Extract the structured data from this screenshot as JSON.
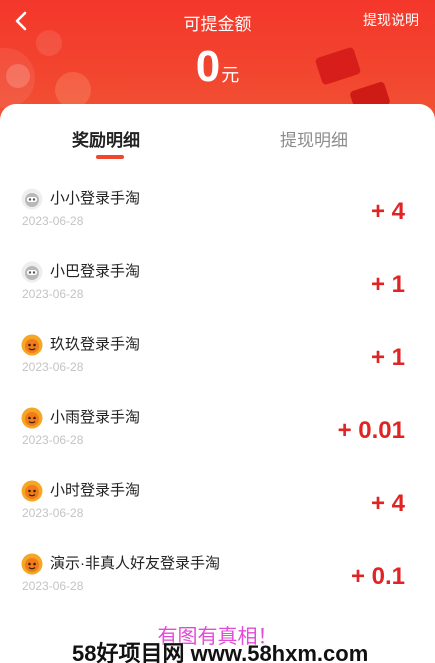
{
  "header": {
    "title": "可提金额",
    "rules_link": "提现说明",
    "amount": "0",
    "unit": "元",
    "bg_color": "#f4372b"
  },
  "tabs": [
    {
      "label": "奖励明细",
      "active": true
    },
    {
      "label": "提现明细",
      "active": false
    }
  ],
  "records": [
    {
      "name": "小小登录手淘",
      "date": "2023-06-28",
      "amount": "+ 4",
      "avatar": "gray-robot-icon"
    },
    {
      "name": "小巴登录手淘",
      "date": "2023-06-28",
      "amount": "+ 1",
      "avatar": "gray-robot-icon"
    },
    {
      "name": "玖玖登录手淘",
      "date": "2023-06-28",
      "amount": "+ 1",
      "avatar": "orange-smiley-icon"
    },
    {
      "name": "小雨登录手淘",
      "date": "2023-06-28",
      "amount": "+ 0.01",
      "avatar": "orange-smiley-icon"
    },
    {
      "name": "小时登录手淘",
      "date": "2023-06-28",
      "amount": "+ 4",
      "avatar": "orange-smiley-icon"
    },
    {
      "name": "演示·非真人好友登录手淘",
      "date": "2023-06-28",
      "amount": "+ 0.1",
      "avatar": "orange-smiley-icon"
    }
  ],
  "watermark": {
    "caption": "有图有真相！",
    "site": "58好项目网 www.58hxm.com"
  },
  "colors": {
    "accent": "#f1462e",
    "reward_text": "#e02424"
  }
}
